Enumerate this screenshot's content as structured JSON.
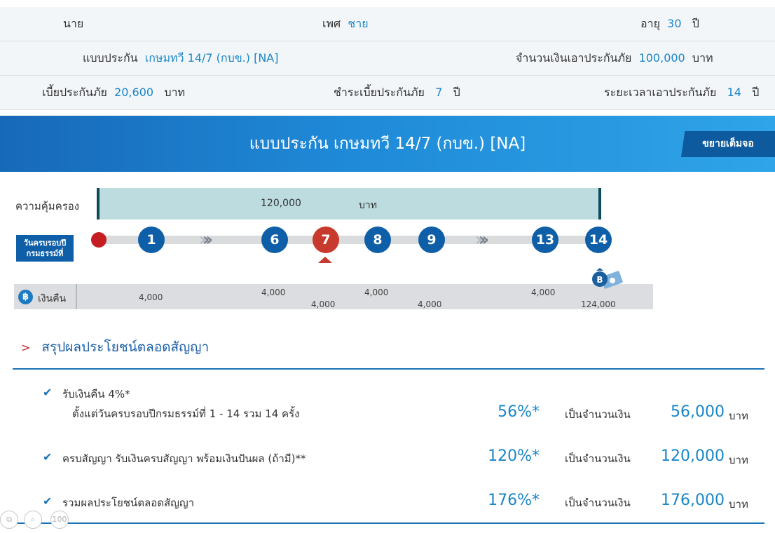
{
  "info": {
    "title_label": "นาย",
    "gender_label": "เพศ",
    "gender_value": "ชาย",
    "age_label": "อายุ",
    "age_value": "30",
    "age_unit": "ปี",
    "plan_label": "แบบประกัน",
    "plan_value": "เกษมทวี 14/7 (กบข.) [NA]",
    "sum_label": "จำนวนเงินเอาประกันภัย",
    "sum_value": "100,000",
    "sum_unit": "บาท",
    "premium_label": "เบี้ยประกันภัย",
    "premium_value": "20,600",
    "premium_unit": "บาท",
    "pay_label": "ชำระเบี้ยประกันภัย",
    "pay_value": "7",
    "pay_unit": "ปี",
    "term_label": "ระยะเวลาเอาประกันภัย",
    "term_value": "14",
    "term_unit": "ปี"
  },
  "banner": {
    "title": "แบบประกัน เกษมทวี 14/7 (กบข.) [NA]",
    "fullscreen_label": "ขยายเต็มจอ"
  },
  "timeline": {
    "coverage_label": "ความคุ้มครอง",
    "coverage_amount": "120,000",
    "coverage_unit": "บาท",
    "anniversary_label_1": "วันครบรอบปี",
    "anniversary_label_2": "กรมธรรม์ที่",
    "years": [
      "1",
      "6",
      "7",
      "8",
      "9",
      "13",
      "14"
    ],
    "current_year": "7",
    "cashback_label": "เงินคืน",
    "cashback_icon": "฿",
    "cashback_amounts": [
      "4,000",
      "4,000",
      "4,000",
      "4,000",
      "4,000",
      "4,000",
      "124,000"
    ]
  },
  "summary": {
    "heading": "สรุปผลประโยชน์ตลอดสัญญา",
    "rows": [
      {
        "text": "รับเงินคืน 4%*",
        "sub": "ตั้งแต่วันครบรอบปีกรมธรรม์ที่ 1 - 14 รวม 14 ครั้ง",
        "pct": "56%*",
        "as": "เป็นจำนวนเงิน",
        "amount": "56,000",
        "unit": "บาท"
      },
      {
        "text": "ครบสัญญา รับเงินครบสัญญา พร้อมเงินปันผล (ถ้ามี)**",
        "pct": "120%*",
        "as": "เป็นจำนวนเงิน",
        "amount": "120,000",
        "unit": "บาท"
      },
      {
        "text": "รวมผลประโยชน์ตลอดสัญญา",
        "pct": "176%*",
        "as": "เป็นจำนวนเงิน",
        "amount": "176,000",
        "unit": "บาท"
      }
    ]
  },
  "toolbar": {
    "zoom_label": "100"
  }
}
